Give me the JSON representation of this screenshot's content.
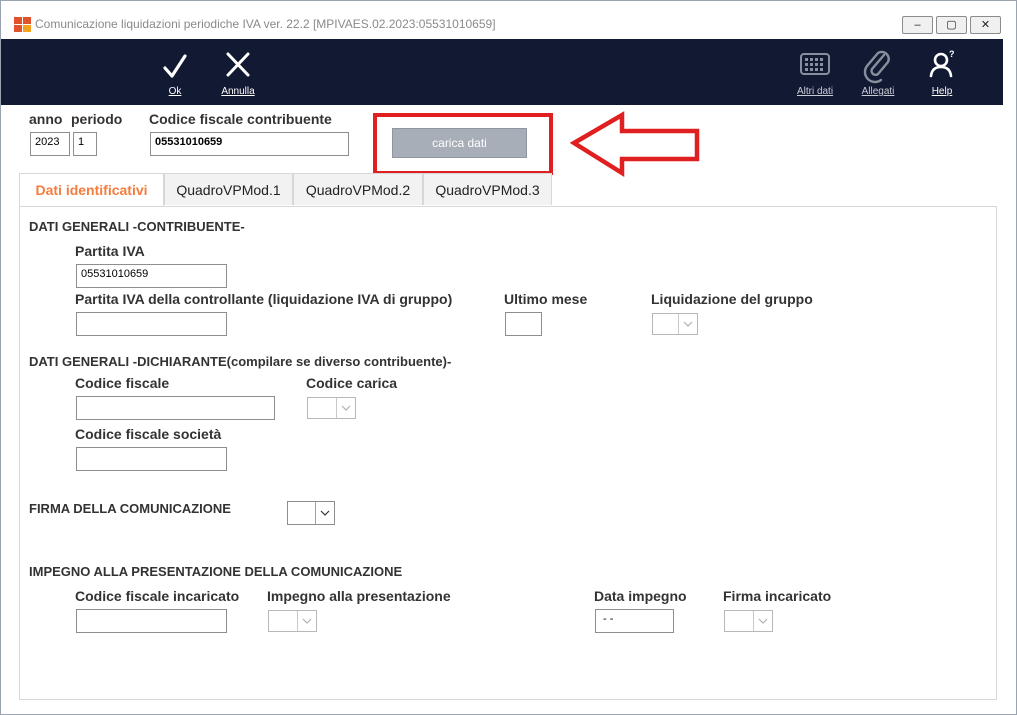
{
  "window": {
    "title": "Comunicazione liquidazioni periodiche IVA  ver. 22.2  [MPIVAES.02.2023:05531010659]",
    "controls": [
      "–",
      "▢",
      "✕"
    ]
  },
  "toolbar": {
    "ok_label": "Ok",
    "annulla_label": "Annulla",
    "altri_dati_label": "Altri dati",
    "allegati_label": "Allegati",
    "help_label": "Help"
  },
  "header": {
    "anno_label": "anno",
    "periodo_label": "periodo",
    "anno_value": "2023",
    "periodo_value": "1",
    "cf_label": "Codice fiscale contribuente",
    "cf_value": "05531010659",
    "carica_label": "carica dati"
  },
  "tabs": [
    {
      "label": "Dati identificativi"
    },
    {
      "label": "QuadroVPMod.1"
    },
    {
      "label": "QuadroVPMod.2"
    },
    {
      "label": "QuadroVPMod.3"
    }
  ],
  "contribuente": {
    "section_title": "DATI GENERALI -CONTRIBUENTE-",
    "partita_iva_label": "Partita IVA",
    "partita_iva_value": "05531010659",
    "piva_controllante_label": "Partita IVA della controllante (liquidazione IVA di gruppo)",
    "piva_controllante_value": "",
    "ultimo_mese_label": "Ultimo mese",
    "ultimo_mese_value": "",
    "liquidazione_gruppo_label": "Liquidazione del gruppo"
  },
  "dichiarante": {
    "section_title": "DATI GENERALI -DICHIARANTE(compilare se diverso contribuente)-",
    "codice_fiscale_label": "Codice fiscale",
    "codice_fiscale_value": "",
    "codice_carica_label": "Codice carica",
    "cf_societa_label": "Codice fiscale società",
    "cf_societa_value": ""
  },
  "firma": {
    "section_title": "FIRMA DELLA COMUNICAZIONE"
  },
  "impegno": {
    "section_title": "IMPEGNO ALLA PRESENTAZIONE DELLA COMUNICAZIONE",
    "cf_incaricato_label": "Codice fiscale incaricato",
    "cf_incaricato_value": "",
    "impegno_label": "Impegno alla presentazione",
    "data_impegno_label": "Data impegno",
    "data_impegno_value": "- -",
    "firma_incaricato_label": "Firma incaricato"
  },
  "colors": {
    "toolbar_bg": "#121933",
    "active_tab": "#f47c3c",
    "highlight_box": "#e02020"
  },
  "icons": {
    "ok": "check-icon",
    "annulla": "x-icon",
    "altri_dati": "keypad-icon",
    "allegati": "paperclip-icon",
    "help": "help-person-icon",
    "annotation": "red-arrow-icon"
  }
}
